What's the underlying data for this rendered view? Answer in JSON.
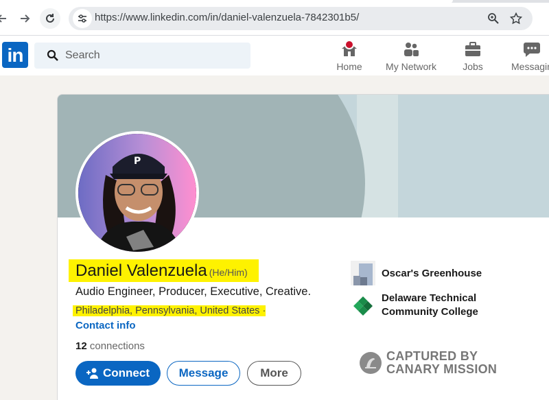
{
  "browser": {
    "url": "https://www.linkedin.com/in/daniel-valenzuela-7842301b5/",
    "back_icon": "back-arrow-icon",
    "forward_icon": "forward-arrow-icon",
    "reload_icon": "reload-icon"
  },
  "header": {
    "logo": "in",
    "search_placeholder": "Search",
    "nav": [
      {
        "label": "Home",
        "icon": "home-icon"
      },
      {
        "label": "My Network",
        "icon": "people-icon"
      },
      {
        "label": "Jobs",
        "icon": "briefcase-icon"
      },
      {
        "label": "Messaging",
        "icon": "chat-icon"
      }
    ]
  },
  "profile": {
    "name": "Daniel Valenzuela",
    "pronouns": "(He/Him)",
    "headline": "Audio Engineer, Producer, Executive, Creative.",
    "location": "Philadelphia, Pennsylvania, United States",
    "location_separator": " ·",
    "contact_info": "Contact info",
    "connections_count": "12",
    "connections_label": "connections",
    "buttons": {
      "connect": "Connect",
      "message": "Message",
      "more": "More"
    },
    "experience": [
      {
        "name": "Oscar's Greenhouse"
      },
      {
        "name_line1": "Delaware Technical",
        "name_line2": "Community College"
      }
    ]
  },
  "watermark": {
    "line1": "CAPTURED BY",
    "line2": "CANARY MISSION"
  },
  "colors": {
    "linkedin_blue": "#0a66c2",
    "highlight": "#fef200"
  }
}
